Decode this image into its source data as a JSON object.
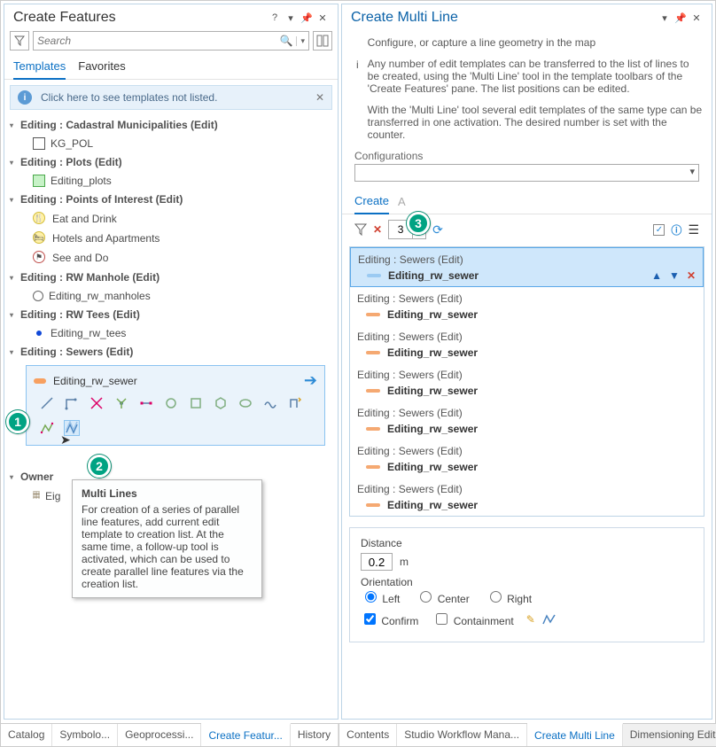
{
  "left_panel": {
    "title": "Create Features",
    "search_placeholder": "Search",
    "tabs": [
      "Templates",
      "Favorites"
    ],
    "active_tab": 0,
    "notice": "Click here to see templates not listed.",
    "groups": [
      {
        "title": "Editing : Cadastral Municipalities (Edit)",
        "items": [
          {
            "swatch": "box-white",
            "label": "KG_POL"
          }
        ]
      },
      {
        "title": "Editing : Plots (Edit)",
        "items": [
          {
            "swatch": "box-green",
            "label": "Editing_plots"
          }
        ]
      },
      {
        "title": "Editing : Points of Interest (Edit)",
        "items": [
          {
            "swatch": "poi-yellow",
            "label": "Eat and Drink"
          },
          {
            "swatch": "poi-yellow2",
            "label": "Hotels and Apartments"
          },
          {
            "swatch": "poi-red",
            "label": "See and Do"
          }
        ]
      },
      {
        "title": "Editing : RW Manhole (Edit)",
        "items": [
          {
            "swatch": "circle-white",
            "label": "Editing_rw_manholes"
          }
        ]
      },
      {
        "title": "Editing : RW Tees (Edit)",
        "items": [
          {
            "swatch": "dot-blue",
            "label": "Editing_rw_tees"
          }
        ]
      },
      {
        "title": "Editing : Sewers (Edit)",
        "items": []
      }
    ],
    "template_card": {
      "label": "Editing_rw_sewer",
      "swatch": "orange-pill"
    },
    "truncated_group": {
      "title": "Owner",
      "items": [
        {
          "label": "Eig"
        }
      ]
    },
    "tooltip": {
      "title": "Multi Lines",
      "body": "For creation of a series of parallel line features, add current edit template to creation list. At the same time, a follow-up tool is activated, which can be used to create parallel line features via the creation list."
    }
  },
  "right_panel": {
    "title": "Create Multi Line",
    "info": {
      "p1": "Configure, or capture a line geometry in the map",
      "p2": "Any number of edit templates can be transferred to the list of lines to be created, using the 'Multi Line' tool in the template toolbars of the 'Create Features' pane. The list positions can be edited.",
      "p3": "With the 'Multi Line' tool several edit templates of the same type can be transferred in one activation. The desired number is set with the counter."
    },
    "config_label": "Configurations",
    "r_tabs": {
      "items": [
        "Create",
        "A"
      ],
      "active": 0
    },
    "count_value": "3",
    "list_group_label": "Editing : Sewers (Edit)",
    "list_item_label": "Editing_rw_sewer",
    "list_count": 7,
    "options": {
      "distance_label": "Distance",
      "distance_value": "0.2",
      "distance_unit": "m",
      "orientation_label": "Orientation",
      "orientation_options": [
        "Left",
        "Center",
        "Right"
      ],
      "orientation_selected": 0,
      "confirm_label": "Confirm",
      "confirm_checked": true,
      "containment_label": "Containment",
      "containment_checked": false
    }
  },
  "bottom_tabs_left": [
    "Catalog",
    "Symbolo...",
    "Geoprocessi...",
    "Create Featur...",
    "History"
  ],
  "bottom_tabs_left_active": 3,
  "bottom_tabs_right": [
    "Contents",
    "Studio Workflow Mana...",
    "Create Multi Line",
    "Dimensioning Edit..."
  ],
  "bottom_tabs_right_active": 2,
  "callouts": {
    "c1": "1",
    "c2": "2",
    "c3": "3"
  }
}
